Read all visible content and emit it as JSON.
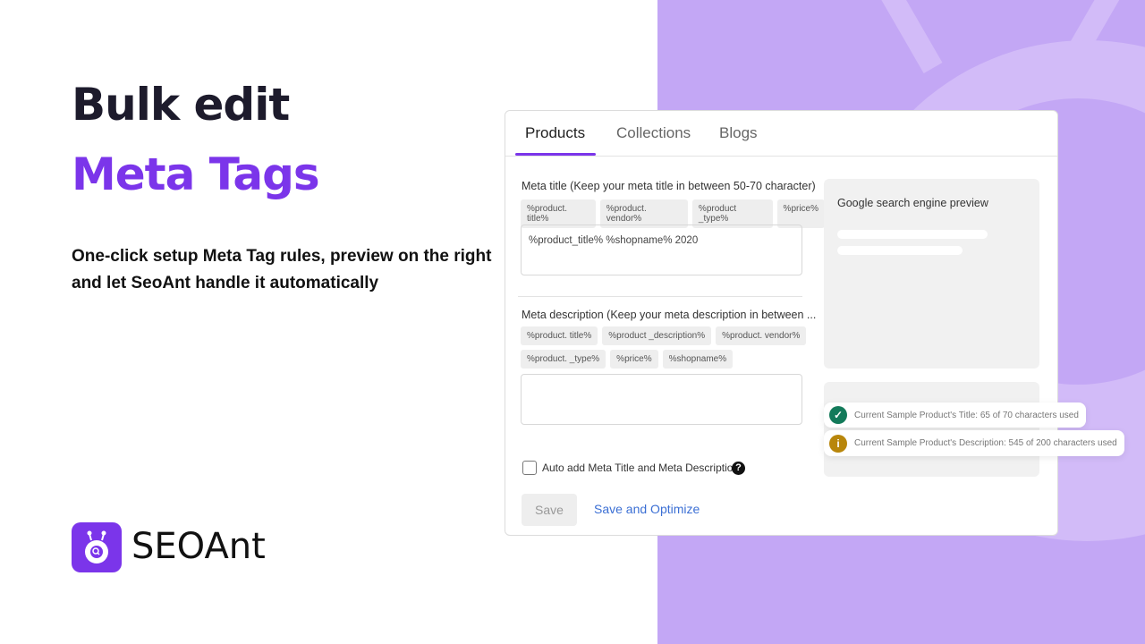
{
  "hero": {
    "title_line1": "Bulk edit",
    "title_line2": "Meta Tags",
    "subtitle": "One-click setup Meta Tag rules, preview on the right and let SeoAnt handle it automatically"
  },
  "brand": {
    "name": "SEOAnt",
    "color": "#7b35ea"
  },
  "tabs": [
    {
      "label": "Products",
      "active": true
    },
    {
      "label": "Collections"
    },
    {
      "label": "Blogs"
    }
  ],
  "meta_title": {
    "label": "Meta title (Keep your meta title in between 50-70 character)",
    "chips": [
      "%product. title%",
      "%product. vendor%",
      "%product _type%",
      "%price%"
    ],
    "value": "%product_title% %shopname% 2020"
  },
  "meta_description": {
    "label": "Meta description (Keep your meta description in between ...",
    "chips": [
      "%product. title%",
      "%product _description%",
      "%product. vendor%",
      "%product. _type%",
      "%price%",
      "%shopname%"
    ],
    "value": ""
  },
  "auto_add": {
    "label": "Auto add Meta Title and Meta Description",
    "checked": false,
    "help_icon": "question-circle-icon"
  },
  "buttons": {
    "save": "Save",
    "save_optimize": "Save and Optimize"
  },
  "preview": {
    "title": "Google search engine preview"
  },
  "toasts": [
    {
      "icon": "check-circle-icon",
      "color": "#137a5a",
      "text": "Current Sample Product's Title: 65 of 70 characters used"
    },
    {
      "icon": "info-circle-icon",
      "color": "#b8860b",
      "text": "Current Sample Product's Description: 545 of 200 characters used"
    }
  ]
}
